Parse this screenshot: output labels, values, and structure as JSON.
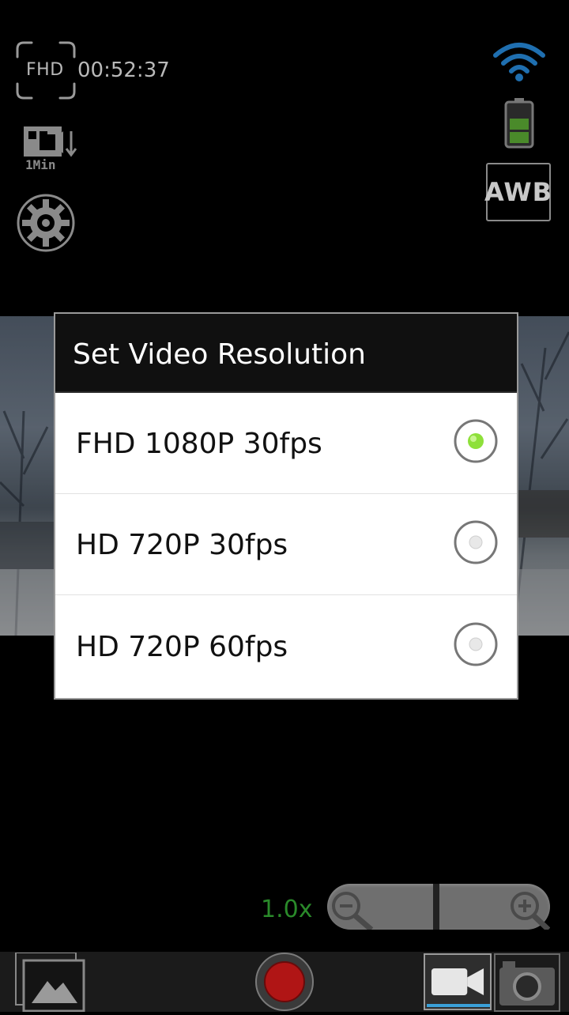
{
  "status": {
    "resolution_badge": "FHD",
    "recording_time": "00:52:37",
    "loop_label": "1Min"
  },
  "controls": {
    "awb_label": "AWB",
    "zoom_level": "1.0x"
  },
  "dialog": {
    "title": "Set Video Resolution",
    "options": [
      {
        "label": "FHD 1080P 30fps",
        "selected": true
      },
      {
        "label": "HD 720P 30fps",
        "selected": false
      },
      {
        "label": "HD 720P 60fps",
        "selected": false
      }
    ]
  },
  "bottom_bar": {
    "active_mode": "video"
  },
  "colors": {
    "selected_radio": "#8ee03a",
    "zoom_text": "#2a8a2a",
    "record": "#b01515",
    "battery_fill": "#4a8a2a"
  },
  "icons": [
    "focus-frame-icon",
    "loop-recording-icon",
    "gear-icon",
    "wifi-icon",
    "battery-icon",
    "zoom-out-icon",
    "zoom-in-icon",
    "gallery-icon",
    "record-icon",
    "video-camera-icon",
    "photo-camera-icon"
  ]
}
